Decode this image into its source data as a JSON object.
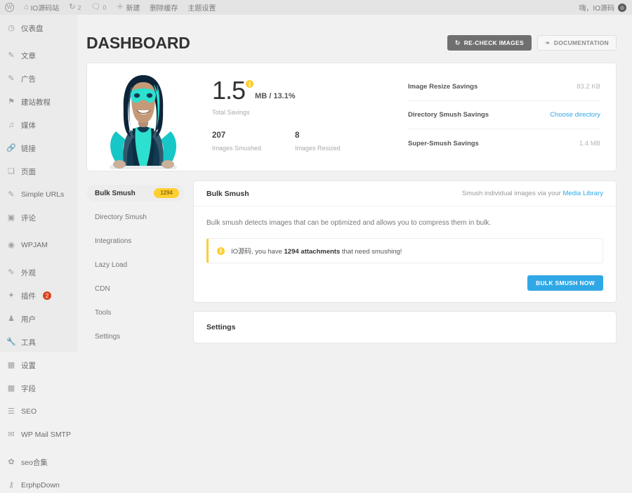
{
  "adminbar": {
    "wp_logo": "wordpress-logo",
    "site_name": "IO源码站",
    "updates_count": "2",
    "comments_count": "0",
    "new_label": "新建",
    "cache_label": "删除缓存",
    "theme_label": "主题设置",
    "greeting": "嗨，IO源码"
  },
  "sidebar": {
    "items": [
      {
        "icon": "dashboard-icon",
        "label": "仪表盘",
        "glyph": "◷",
        "badge": "",
        "gap_after": true
      },
      {
        "icon": "posts-icon",
        "label": "文章",
        "glyph": "✎",
        "badge": "",
        "gap_after": false
      },
      {
        "icon": "ads-icon",
        "label": "广告",
        "glyph": "✎",
        "badge": "",
        "gap_after": false
      },
      {
        "icon": "tutorial-icon",
        "label": "建站教程",
        "glyph": "⚑",
        "badge": "",
        "gap_after": false
      },
      {
        "icon": "media-icon",
        "label": "媒体",
        "glyph": "♫",
        "badge": "",
        "gap_after": false
      },
      {
        "icon": "links-icon",
        "label": "链接",
        "glyph": "🔗",
        "badge": "",
        "gap_after": false
      },
      {
        "icon": "pages-icon",
        "label": "页面",
        "glyph": "❏",
        "badge": "",
        "gap_after": false
      },
      {
        "icon": "simple-urls-icon",
        "label": "Simple URLs",
        "glyph": "✎",
        "badge": "",
        "gap_after": false
      },
      {
        "icon": "comments-icon",
        "label": "评论",
        "glyph": "▣",
        "badge": "",
        "gap_after": true
      },
      {
        "icon": "wpjam-icon",
        "label": "WPJAM",
        "glyph": "◉",
        "badge": "",
        "gap_after": true
      },
      {
        "icon": "appearance-icon",
        "label": "外观",
        "glyph": "✎",
        "badge": "",
        "gap_after": false
      },
      {
        "icon": "plugins-icon",
        "label": "插件",
        "glyph": "✦",
        "badge": "2",
        "gap_after": false
      },
      {
        "icon": "users-icon",
        "label": "用户",
        "glyph": "♟",
        "badge": "",
        "gap_after": false
      },
      {
        "icon": "tools-icon",
        "label": "工具",
        "glyph": "🔧",
        "badge": "",
        "gap_after": false
      },
      {
        "icon": "settings-icon",
        "label": "设置",
        "glyph": "▦",
        "badge": "",
        "gap_after": false
      },
      {
        "icon": "fields-icon",
        "label": "字段",
        "glyph": "▩",
        "badge": "",
        "gap_after": false
      },
      {
        "icon": "seo-icon",
        "label": "SEO",
        "glyph": "☰",
        "badge": "",
        "gap_after": false
      },
      {
        "icon": "mail-smtp-icon",
        "label": "WP Mail SMTP",
        "glyph": "✉",
        "badge": "",
        "gap_after": true
      },
      {
        "icon": "seo-collection-icon",
        "label": "seo合集",
        "glyph": "✿",
        "badge": "",
        "gap_after": false
      },
      {
        "icon": "erphpdown-icon",
        "label": "ErphpDown",
        "glyph": "⚷",
        "badge": "",
        "gap_after": false
      }
    ]
  },
  "header": {
    "title": "DASHBOARD",
    "recheck_label": "RE-CHECK IMAGES",
    "recheck_icon": "refresh-icon",
    "docs_label": "DOCUMENTATION",
    "docs_icon": "book-icon"
  },
  "stats": {
    "hero_alt": "smush-superhero-illustration",
    "total_value": "1.5",
    "total_unit": "MB / 13.1%",
    "total_label": "Total Savings",
    "info_glyph": "i",
    "mini": [
      {
        "value": "207",
        "label": "Images Smushed"
      },
      {
        "value": "8",
        "label": "Images Resized"
      }
    ],
    "savings_rows": [
      {
        "name": "Image Resize Savings",
        "value": "83.2 KB",
        "is_link": false
      },
      {
        "name": "Directory Smush Savings",
        "value": "Choose directory",
        "is_link": true
      },
      {
        "name": "Super-Smush Savings",
        "value": "1.4 MB",
        "is_link": false
      }
    ]
  },
  "tabs": [
    {
      "label": "Bulk Smush",
      "badge": "1294",
      "active": true
    },
    {
      "label": "Directory Smush",
      "badge": "",
      "active": false
    },
    {
      "label": "Integrations",
      "badge": "",
      "active": false
    },
    {
      "label": "Lazy Load",
      "badge": "",
      "active": false
    },
    {
      "label": "CDN",
      "badge": "",
      "active": false
    },
    {
      "label": "Tools",
      "badge": "",
      "active": false
    },
    {
      "label": "Settings",
      "badge": "",
      "active": false
    }
  ],
  "panel": {
    "title": "Bulk Smush",
    "sub_prefix": "Smush individual images via your ",
    "sub_link": "Media Library",
    "description": "Bulk smush detects images that can be optimized and allows you to compress them in bulk.",
    "notice_prefix": "IO源码, you have ",
    "notice_strong": "1294 attachments",
    "notice_suffix": " that need smushing!",
    "notice_icon_glyph": "i",
    "action_label": "BULK SMUSH NOW"
  },
  "settings_card": {
    "title": "Settings"
  },
  "colors": {
    "accent_blue": "#30a8e6",
    "accent_yellow": "#fecf2f",
    "badge_red": "#d9441f",
    "dark_button": "#6f6f6f",
    "sidebar_bg": "#ebebeb",
    "adminbar_bg": "#e4e4e4"
  }
}
